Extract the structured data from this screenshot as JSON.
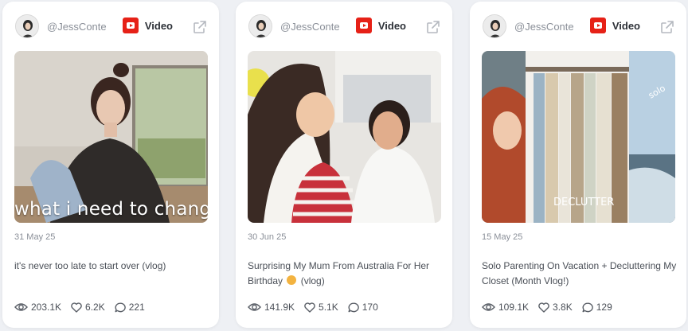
{
  "colors": {
    "youtube_red": "#e62117",
    "text_muted": "#8a8f98",
    "text_body": "#4a4f57",
    "card_bg": "#ffffff",
    "page_bg": "#eef0f4"
  },
  "cards": [
    {
      "handle": "@JessConte",
      "platform_label": "Video",
      "platform_icon": "youtube-icon",
      "thumbnail_caption": "what i need to change",
      "date": "31 May 25",
      "title": "it's never too late to start over (vlog)",
      "views": "203.1K",
      "likes": "6.2K",
      "comments": "221"
    },
    {
      "handle": "@JessConte",
      "platform_label": "Video",
      "platform_icon": "youtube-icon",
      "date": "30 Jun 25",
      "title_before_emoji": "Surprising My Mum From Australia For Her Birthday",
      "title_emoji": "smiling-face-emoji",
      "title_after_emoji": "(vlog)",
      "views": "141.9K",
      "likes": "5.1K",
      "comments": "170"
    },
    {
      "handle": "@JessConte",
      "platform_label": "Video",
      "platform_icon": "youtube-icon",
      "thumbnail_caption": "DECLUTTER",
      "thumbnail_caption_2": "solo",
      "date": "15 May 25",
      "title": "Solo Parenting On Vacation + Decluttering My Closet (Month Vlog!)",
      "views": "109.1K",
      "likes": "3.8K",
      "comments": "129"
    }
  ]
}
